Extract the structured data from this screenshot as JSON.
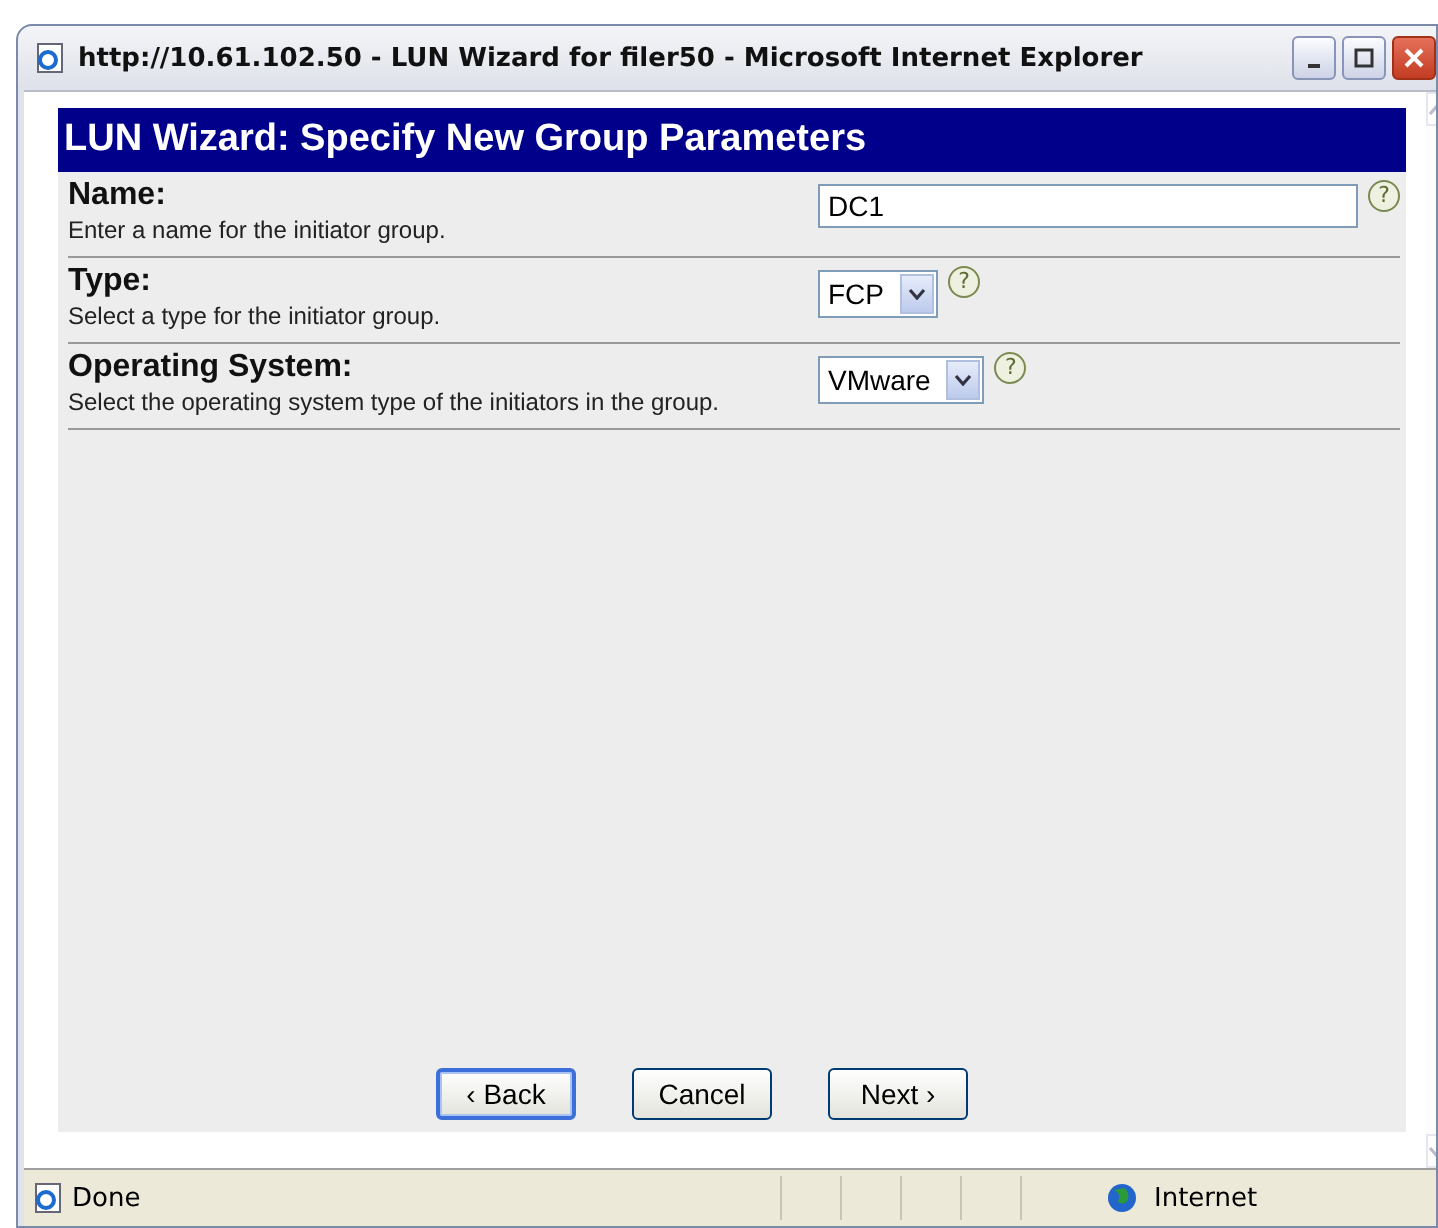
{
  "window": {
    "title": "http://10.61.102.50 - LUN Wizard for filer50 - Microsoft Internet Explorer"
  },
  "page": {
    "heading": "LUN Wizard: Specify New Group Parameters",
    "fields": [
      {
        "kind": "text",
        "label": "Name:",
        "description": "Enter a name for the initiator group.",
        "value": "DC1",
        "help": "?"
      },
      {
        "kind": "select",
        "label": "Type:",
        "description": "Select a type for the initiator group.",
        "value": "FCP",
        "help": "?"
      },
      {
        "kind": "select",
        "label": "Operating System:",
        "description": "Select the operating system type of the initiators in the group.",
        "value": "VMware",
        "help": "?"
      }
    ],
    "buttons": [
      {
        "label": "‹ Back",
        "focused": true
      },
      {
        "label": "Cancel",
        "focused": false
      },
      {
        "label": "Next ›",
        "focused": false
      }
    ]
  },
  "status_bar": {
    "status": "Done",
    "zone": "Internet"
  }
}
